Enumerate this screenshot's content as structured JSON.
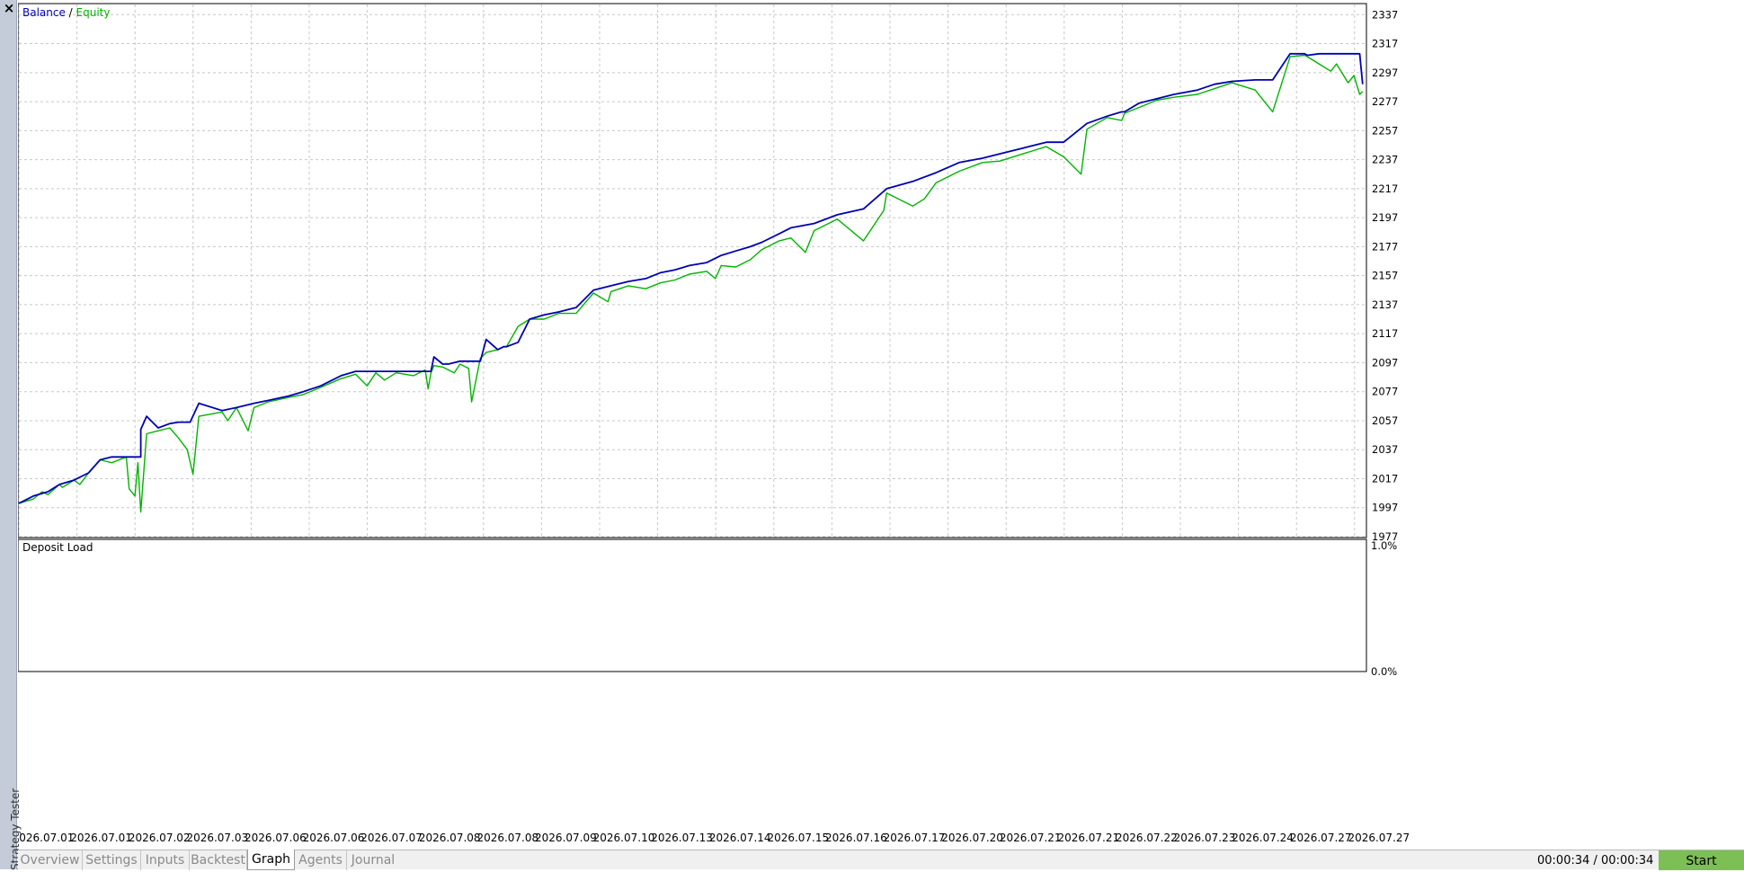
{
  "side_panel": {
    "title": "Strategy Tester",
    "close_label": "×"
  },
  "chart_data": [
    {
      "type": "line",
      "legend": [
        "Balance",
        "Equity"
      ],
      "legend_placement": "top-left",
      "legend_separator": " / ",
      "colors": {
        "Balance": "#0000b4",
        "Equity": "#00b400"
      },
      "grid": true,
      "y_ticks": [
        1977,
        1997,
        2017,
        2037,
        2057,
        2077,
        2097,
        2117,
        2137,
        2157,
        2177,
        2197,
        2217,
        2237,
        2257,
        2277,
        2297,
        2317,
        2337
      ],
      "ylim": [
        1977,
        2344
      ],
      "x_tick_labels": [
        "2026.07.01",
        "2026.07.01",
        "2026.07.02",
        "2026.07.03",
        "2026.07.06",
        "2026.07.06",
        "2026.07.07",
        "2026.07.08",
        "2026.07.08",
        "2026.07.09",
        "2026.07.10",
        "2026.07.13",
        "2026.07.14",
        "2026.07.15",
        "2026.07.16",
        "2026.07.17",
        "2026.07.20",
        "2026.07.21",
        "2026.07.21",
        "2026.07.22",
        "2026.07.23",
        "2026.07.24",
        "2026.07.27",
        "2026.07.27"
      ],
      "xlim": [
        0,
        23.2
      ],
      "series": [
        {
          "name": "Balance",
          "x": [
            0,
            0.25,
            0.5,
            0.7,
            0.95,
            1.2,
            1.4,
            1.6,
            1.95,
            2.1,
            2.1,
            2.2,
            2.4,
            2.6,
            2.75,
            2.95,
            3.1,
            3.5,
            3.75,
            4.05,
            4.3,
            4.65,
            4.9,
            5.2,
            5.55,
            5.8,
            6.05,
            6.2,
            6.5,
            6.8,
            7.1,
            7.15,
            7.3,
            7.4,
            7.6,
            7.75,
            7.8,
            7.95,
            8.05,
            8.25,
            8.35,
            8.4,
            8.6,
            8.8,
            9.05,
            9.3,
            9.6,
            9.9,
            10.2,
            10.5,
            10.8,
            11.05,
            11.3,
            11.55,
            11.85,
            12.1,
            12.35,
            12.6,
            12.8,
            13.1,
            13.3,
            13.7,
            14.1,
            14.55,
            14.95,
            15.4,
            15.8,
            16.2,
            16.6,
            16.9,
            17.3,
            17.7,
            18.0,
            18.4,
            18.75,
            19.0,
            19.05,
            19.3,
            19.6,
            19.9,
            20.3,
            20.6,
            20.9,
            21.3,
            21.6,
            21.9,
            22.15,
            22.2,
            22.4,
            22.6,
            22.9,
            23.1,
            23.15
          ],
          "y": [
            2000,
            2005,
            2008,
            2013,
            2016,
            2021,
            2030,
            2032,
            2032,
            2032,
            2051,
            2060,
            2052,
            2055,
            2056,
            2056,
            2069,
            2064,
            2066,
            2069,
            2071,
            2074,
            2077,
            2081,
            2088,
            2091,
            2091,
            2091,
            2091,
            2091,
            2091,
            2101,
            2096,
            2096,
            2098,
            2098,
            2098,
            2098,
            2113,
            2106,
            2108,
            2108,
            2111,
            2127,
            2130,
            2132,
            2135,
            2147,
            2150,
            2153,
            2155,
            2159,
            2161,
            2164,
            2166,
            2171,
            2174,
            2177,
            2180,
            2186,
            2190,
            2193,
            2199,
            2203,
            2217,
            2222,
            2228,
            2235,
            2238,
            2241,
            2245,
            2249,
            2249,
            2262,
            2267,
            2270,
            2270,
            2276,
            2279,
            2282,
            2285,
            2289,
            2291,
            2292,
            2292,
            2310,
            2310,
            2309,
            2310,
            2310,
            2310,
            2310,
            2289
          ]
        },
        {
          "name": "Equity",
          "x": [
            0,
            0.25,
            0.4,
            0.5,
            0.7,
            0.75,
            0.95,
            1.05,
            1.2,
            1.4,
            1.6,
            1.85,
            1.9,
            2.0,
            2.05,
            2.1,
            2.2,
            2.4,
            2.6,
            2.75,
            2.9,
            3.0,
            3.1,
            3.5,
            3.6,
            3.75,
            3.95,
            4.05,
            4.3,
            4.65,
            4.9,
            5.2,
            5.55,
            5.8,
            6.0,
            6.15,
            6.3,
            6.5,
            6.8,
            7.0,
            7.05,
            7.1,
            7.15,
            7.3,
            7.5,
            7.6,
            7.75,
            7.8,
            7.95,
            8.05,
            8.25,
            8.35,
            8.4,
            8.6,
            8.8,
            9.05,
            9.3,
            9.6,
            9.9,
            10.15,
            10.2,
            10.5,
            10.8,
            11.05,
            11.3,
            11.55,
            11.85,
            12.0,
            12.1,
            12.35,
            12.6,
            12.8,
            13.1,
            13.3,
            13.55,
            13.7,
            14.1,
            14.55,
            14.9,
            14.95,
            15.4,
            15.6,
            15.8,
            16.2,
            16.6,
            16.9,
            17.3,
            17.7,
            18.0,
            18.3,
            18.4,
            18.75,
            19.0,
            19.05,
            19.3,
            19.6,
            19.9,
            20.3,
            20.6,
            20.9,
            21.3,
            21.6,
            21.9,
            22.15,
            22.2,
            22.4,
            22.6,
            22.7,
            22.9,
            23.0,
            23.1,
            23.15
          ],
          "y": [
            2000,
            2003,
            2008,
            2006,
            2013,
            2011,
            2016,
            2013,
            2021,
            2030,
            2028,
            2032,
            2010,
            2005,
            2028,
            1994,
            2048,
            2050,
            2052,
            2045,
            2037,
            2020,
            2060,
            2063,
            2057,
            2066,
            2050,
            2066,
            2070,
            2073,
            2075,
            2080,
            2086,
            2089,
            2081,
            2090,
            2085,
            2090,
            2088,
            2092,
            2079,
            2090,
            2095,
            2094,
            2090,
            2096,
            2093,
            2070,
            2100,
            2104,
            2106,
            2108,
            2108,
            2122,
            2127,
            2127,
            2131,
            2131,
            2145,
            2139,
            2146,
            2150,
            2148,
            2152,
            2154,
            2158,
            2160,
            2155,
            2164,
            2163,
            2168,
            2175,
            2181,
            2183,
            2173,
            2188,
            2196,
            2181,
            2202,
            2214,
            2205,
            2210,
            2221,
            2229,
            2235,
            2236,
            2241,
            2246,
            2239,
            2227,
            2258,
            2266,
            2264,
            2269,
            2273,
            2278,
            2280,
            2282,
            2286,
            2290,
            2285,
            2270,
            2308,
            2309,
            2308,
            2303,
            2298,
            2303,
            2290,
            2295,
            2282,
            2284
          ]
        }
      ]
    },
    {
      "type": "line",
      "title": "Deposit Load",
      "y_tick_labels": [
        "1.0%",
        "0.0%"
      ],
      "ylim": [
        0,
        1.0
      ],
      "grid": false
    }
  ],
  "tabs": [
    {
      "label": "Overview",
      "active": false
    },
    {
      "label": "Settings",
      "active": false
    },
    {
      "label": "Inputs",
      "active": false
    },
    {
      "label": "Backtest",
      "active": false
    },
    {
      "label": "Graph",
      "active": true
    },
    {
      "label": "Agents",
      "active": false
    },
    {
      "label": "Journal",
      "active": false
    }
  ],
  "status": {
    "timer": "00:00:34 / 00:00:34",
    "start_label": "Start"
  }
}
